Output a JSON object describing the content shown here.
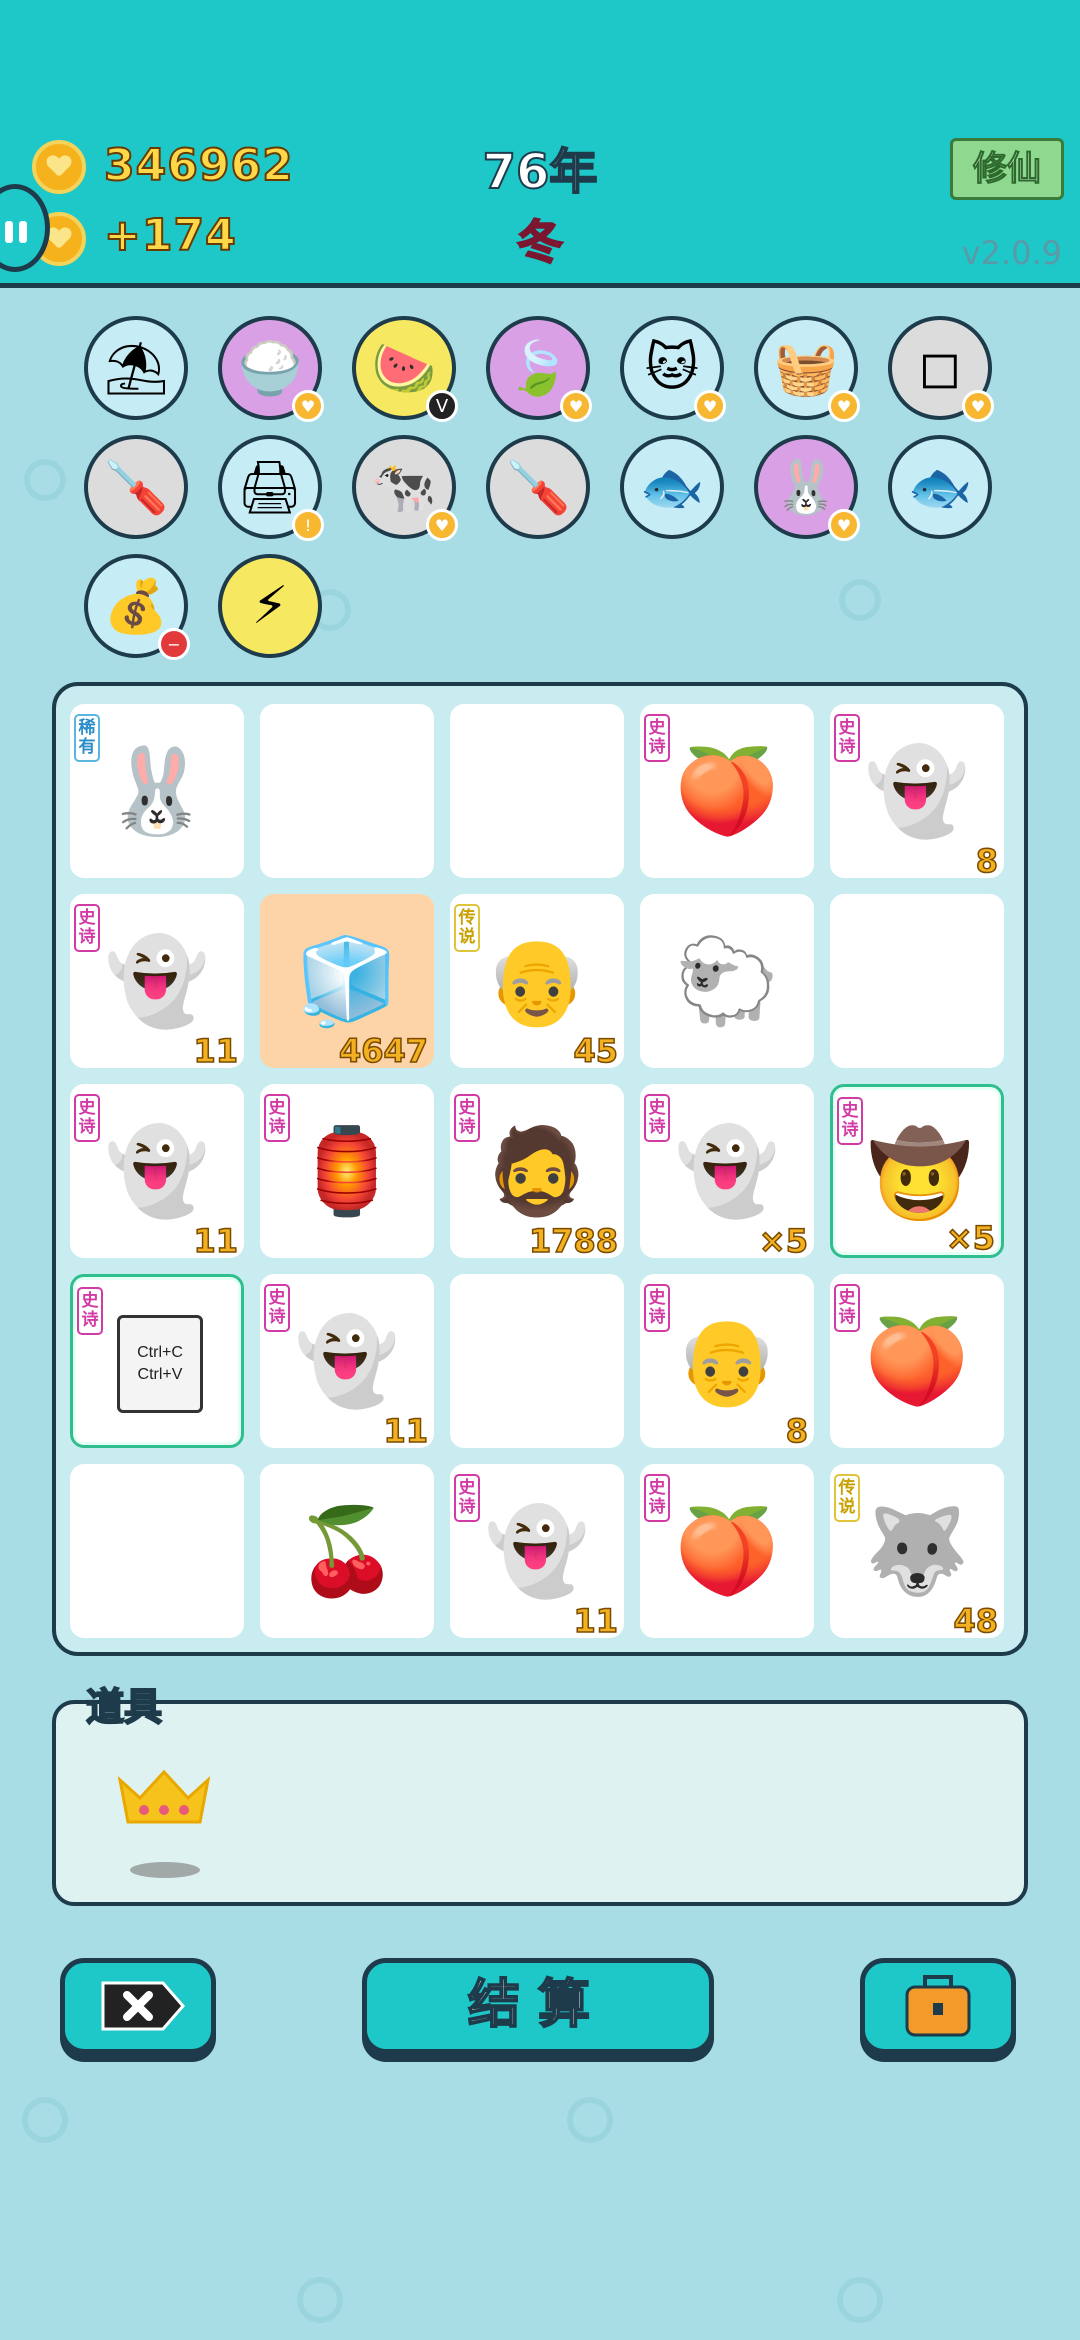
{
  "header": {
    "coins": "346962",
    "income": "+174",
    "year": "76年",
    "season": "冬",
    "mode_button": "修仙",
    "version": "v2.0.9"
  },
  "inventory": [
    {
      "icon": "skirt-icon",
      "bg": "#c6ecf5",
      "glyph": "⛱"
    },
    {
      "icon": "rice-bowl-icon",
      "bg": "#d9a0e6",
      "glyph": "🍚",
      "badge": "heart"
    },
    {
      "icon": "fruit-platter-icon",
      "bg": "#f7e862",
      "glyph": "🍉",
      "badge": "V"
    },
    {
      "icon": "leaf-icon",
      "bg": "#d9a0e6",
      "glyph": "🍃",
      "badge": "heart"
    },
    {
      "icon": "cat-icon",
      "bg": "#c6ecf5",
      "glyph": "🐱",
      "badge": "heart"
    },
    {
      "icon": "fruit-basket-icon",
      "bg": "#c6ecf5",
      "glyph": "🧺",
      "badge": "heart"
    },
    {
      "icon": "sugar-cubes-icon",
      "bg": "#dcdcdc",
      "glyph": "◻",
      "badge": "heart"
    },
    {
      "icon": "screwdriver-icon",
      "bg": "#dcdcdc",
      "glyph": "🪛"
    },
    {
      "icon": "printer-icon",
      "bg": "#c6ecf5",
      "glyph": "🖨",
      "badge": "warn"
    },
    {
      "icon": "cows-icon",
      "bg": "#dcdcdc",
      "glyph": "🐄",
      "badge": "heart"
    },
    {
      "icon": "screwdriver-icon",
      "bg": "#dcdcdc",
      "glyph": "🪛"
    },
    {
      "icon": "fish-bowl-icon",
      "bg": "#c6ecf5",
      "glyph": "🐟"
    },
    {
      "icon": "rabbit-icon",
      "bg": "#d9a0e6",
      "glyph": "🐰",
      "badge": "heart"
    },
    {
      "icon": "fish-bowl-icon",
      "bg": "#c6ecf5",
      "glyph": "🐟"
    },
    {
      "icon": "money-bag-icon",
      "bg": "#c6ecf5",
      "glyph": "💰",
      "badge": "minus"
    },
    {
      "icon": "lightning-icon",
      "bg": "#f7e862",
      "glyph": "⚡"
    }
  ],
  "board": [
    {
      "icon": "rabbit-red-shirt-icon",
      "glyph": "🐰",
      "tag": "稀有",
      "tag_type": "rare",
      "count": ""
    },
    {
      "icon": "empty",
      "glyph": "",
      "tag": "",
      "tag_type": "",
      "count": ""
    },
    {
      "icon": "empty",
      "glyph": "",
      "tag": "",
      "tag_type": "",
      "count": ""
    },
    {
      "icon": "peach-icon",
      "glyph": "🍑",
      "tag": "史诗",
      "tag_type": "epic",
      "count": ""
    },
    {
      "icon": "ghost-icon",
      "glyph": "👻",
      "tag": "史诗",
      "tag_type": "epic",
      "count": "8"
    },
    {
      "icon": "ghost-icon",
      "glyph": "👻",
      "tag": "史诗",
      "tag_type": "epic",
      "count": "11"
    },
    {
      "icon": "fridge-icon",
      "glyph": "🧊",
      "tag": "",
      "tag_type": "",
      "count": "4647",
      "orange": true
    },
    {
      "icon": "old-man-glasses-icon",
      "glyph": "👴",
      "tag": "传说",
      "tag_type": "legend",
      "count": "45"
    },
    {
      "icon": "sheep-icon",
      "glyph": "🐑",
      "tag": "",
      "tag_type": "",
      "count": ""
    },
    {
      "icon": "empty",
      "glyph": "",
      "tag": "",
      "tag_type": "",
      "count": ""
    },
    {
      "icon": "ghost-icon",
      "glyph": "👻",
      "tag": "史诗",
      "tag_type": "epic",
      "count": "11"
    },
    {
      "icon": "rabbit-house-icon",
      "glyph": "🏮",
      "tag": "史诗",
      "tag_type": "epic",
      "count": ""
    },
    {
      "icon": "bearded-man-icon",
      "glyph": "🧔",
      "tag": "史诗",
      "tag_type": "epic",
      "count": "1788"
    },
    {
      "icon": "ghost-icon",
      "glyph": "👻",
      "tag": "史诗",
      "tag_type": "epic",
      "count": "×5"
    },
    {
      "icon": "cowboy-icon",
      "glyph": "🤠",
      "tag": "史诗",
      "tag_type": "epic",
      "count": "×5",
      "selected": true
    },
    {
      "icon": "copy-paste-icon",
      "glyph": "📋",
      "tag": "史诗",
      "tag_type": "epic",
      "count": "",
      "selected": true,
      "text": "Ctrl+C Ctrl+V"
    },
    {
      "icon": "ghost-icon",
      "glyph": "👻",
      "tag": "史诗",
      "tag_type": "epic",
      "count": "11"
    },
    {
      "icon": "empty",
      "glyph": "",
      "tag": "",
      "tag_type": "",
      "count": ""
    },
    {
      "icon": "old-man-ghost-icon",
      "glyph": "👴",
      "tag": "史诗",
      "tag_type": "epic",
      "count": "8"
    },
    {
      "icon": "peach-icon",
      "glyph": "🍑",
      "tag": "史诗",
      "tag_type": "epic",
      "count": ""
    },
    {
      "icon": "empty",
      "glyph": "",
      "tag": "",
      "tag_type": "",
      "count": ""
    },
    {
      "icon": "cherry-icon",
      "glyph": "🍒",
      "tag": "",
      "tag_type": "",
      "count": ""
    },
    {
      "icon": "ghost-icon",
      "glyph": "👻",
      "tag": "史诗",
      "tag_type": "epic",
      "count": "11"
    },
    {
      "icon": "peach-icon",
      "glyph": "🍑",
      "tag": "史诗",
      "tag_type": "epic",
      "count": ""
    },
    {
      "icon": "husky-crown-icon",
      "glyph": "🐺",
      "tag": "传说",
      "tag_type": "legend",
      "count": "48"
    }
  ],
  "items_panel": {
    "title": "道具",
    "items": [
      {
        "icon": "crown-icon",
        "glyph": "👑"
      }
    ]
  },
  "buttons": {
    "settle_label": "结算"
  }
}
